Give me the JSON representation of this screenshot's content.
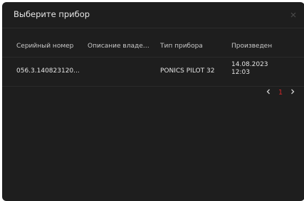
{
  "dialog": {
    "title": "Выберите прибор",
    "close_icon": "close-icon"
  },
  "table": {
    "columns": [
      "Серийный номер",
      "Описание владель...",
      "Тип прибора",
      "Произведен"
    ],
    "rows": [
      {
        "serial": "056.3.140823120...",
        "description": "",
        "device_type": "PONICS PILOT 32",
        "produced_date": "14.08.2023",
        "produced_time": "12:03"
      }
    ]
  },
  "pagination": {
    "prev_icon": "chevron-left-icon",
    "current_page": "1",
    "next_icon": "chevron-right-icon",
    "accent_color": "#d8282a"
  }
}
